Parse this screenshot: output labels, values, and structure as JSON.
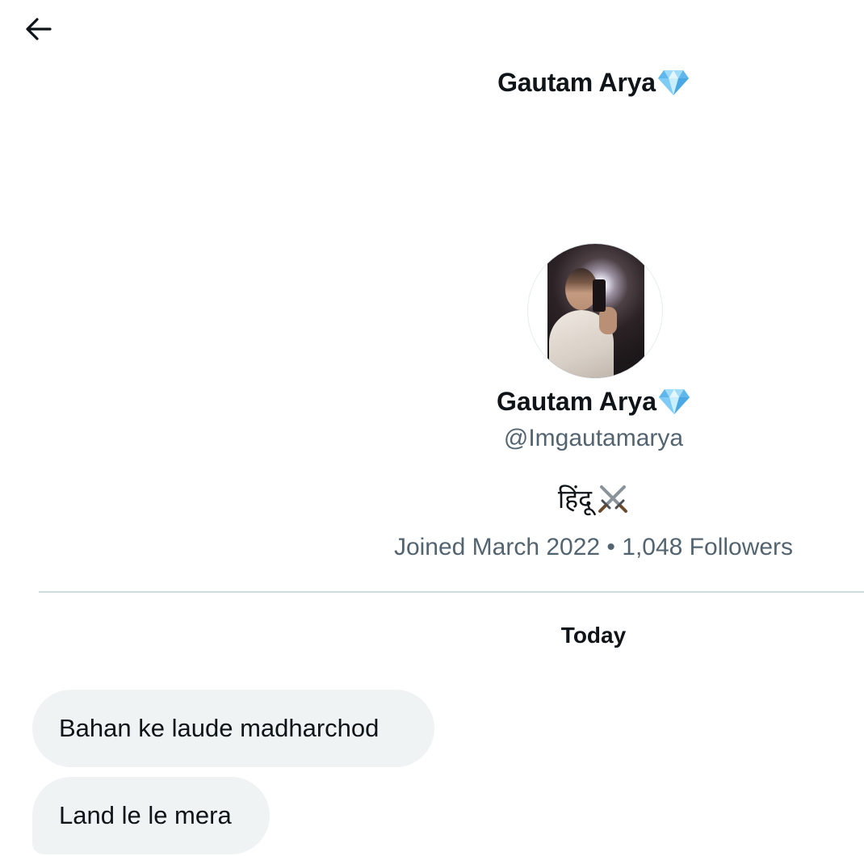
{
  "header": {
    "title": "Gautam Arya",
    "back_icon": "arrow-left-icon",
    "title_emoji": "gem-stone-icon"
  },
  "profile": {
    "name": "Gautam Arya",
    "name_emoji": "gem-stone-icon",
    "handle": "@Imgautamarya",
    "bio": "हिंदू",
    "bio_emoji": "crossed-swords-icon",
    "meta": "Joined March 2022 • 1,048 Followers"
  },
  "conversation": {
    "day_label": "Today",
    "messages": [
      {
        "text": "Bahan ke laude madharchod"
      },
      {
        "text": "Land le le mera"
      }
    ]
  },
  "colors": {
    "text_primary": "#0f1419",
    "text_secondary": "#536471",
    "bubble_bg": "#eff3f4",
    "divider": "#cfd9de",
    "gem_blue": "#7ecbf5"
  }
}
